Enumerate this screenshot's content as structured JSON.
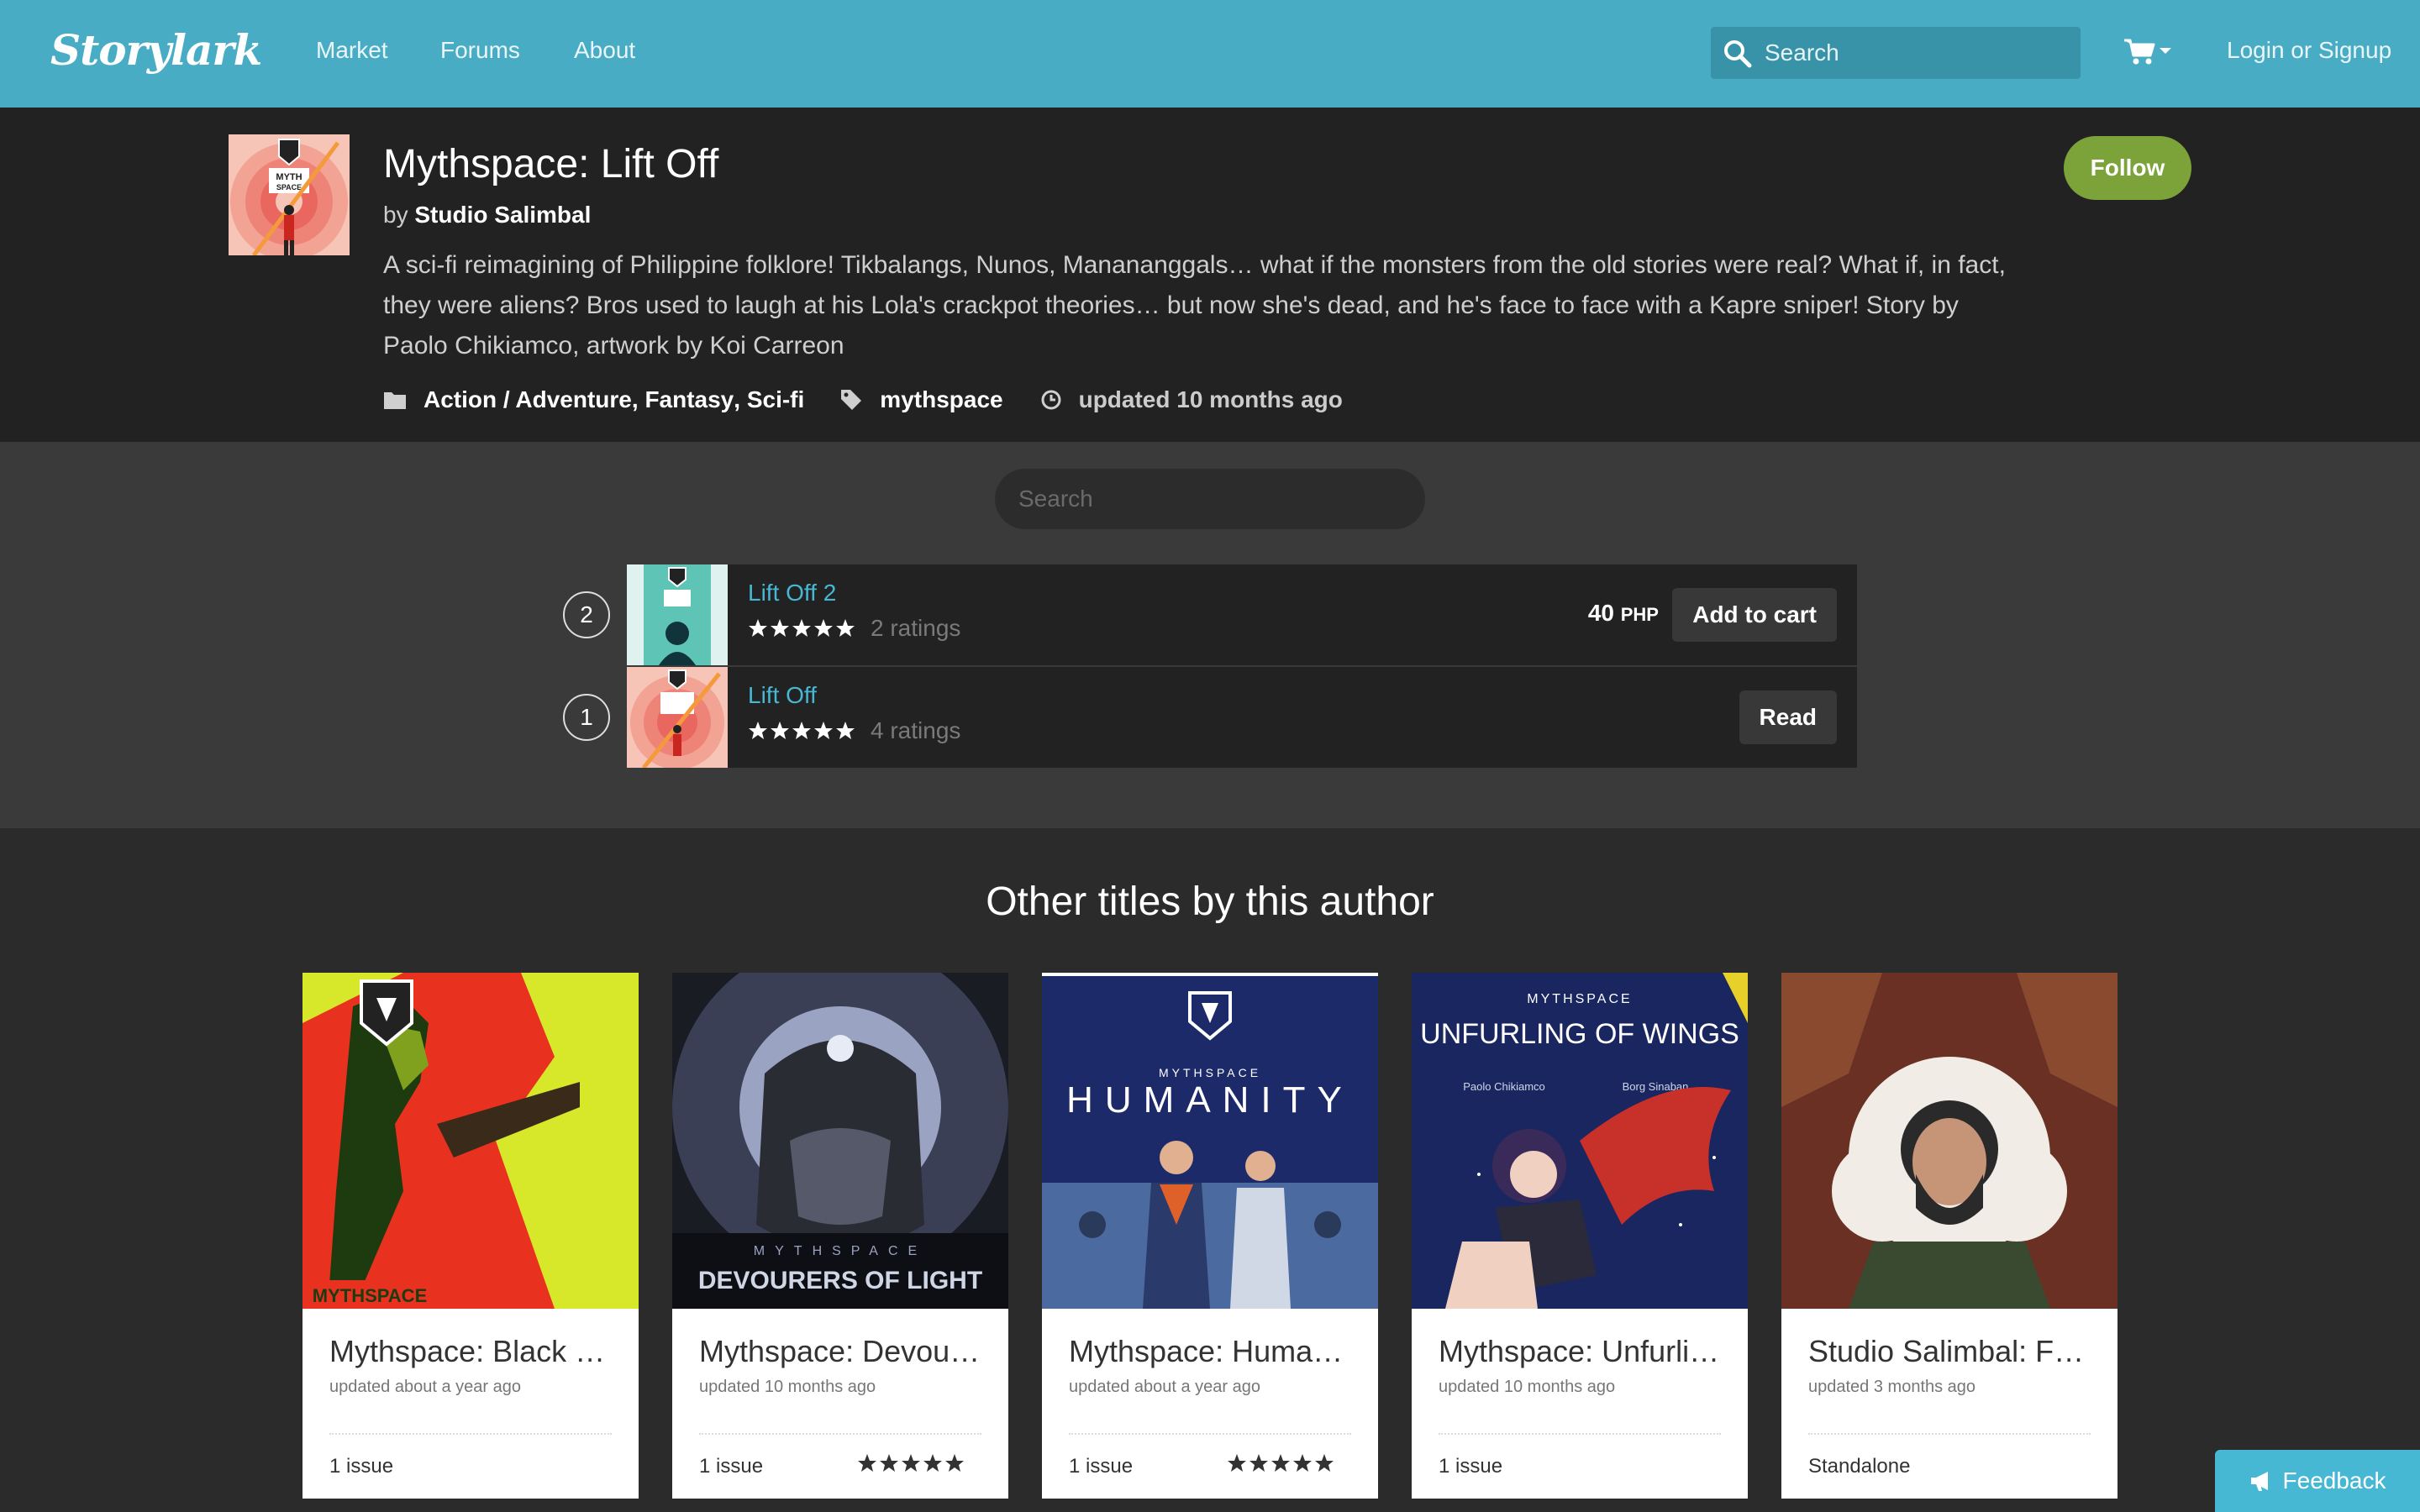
{
  "navbar": {
    "logo": "Storylark",
    "links": [
      "Market",
      "Forums",
      "About"
    ],
    "search_placeholder": "Search",
    "login": "Login or Signup"
  },
  "series": {
    "title": "Mythspace: Lift Off",
    "by_label": "by",
    "author": "Studio Salimbal",
    "description": "A sci-fi reimagining of Philippine folklore! Tikbalangs, Nunos, Manananggals… what if the monsters from the old stories were real? What if, in fact, they were aliens? Bros used to laugh at his Lola's crackpot theories… but now she's dead, and he's face to face with a Kapre sniper! Story by Paolo Chikiamco, artwork by Koi Carreon",
    "genres": [
      "Action / Adventure",
      "Fantasy",
      "Sci-fi"
    ],
    "tag": "mythspace",
    "updated": "updated 10 months ago",
    "follow_label": "Follow"
  },
  "issues": {
    "search_placeholder": "Search",
    "items": [
      {
        "number": "2",
        "name": "Lift Off 2",
        "ratings": "2 ratings",
        "price": "40",
        "currency": "PHP",
        "action": "Add to cart",
        "stars": 5
      },
      {
        "number": "1",
        "name": "Lift Off",
        "ratings": "4 ratings",
        "action": "Read",
        "stars": 5
      }
    ]
  },
  "other_titles": {
    "heading": "Other titles by this author",
    "cards": [
      {
        "title": "Mythspace: Black m…",
        "updated": "updated about a year ago",
        "issues": "1 issue",
        "stars": 0
      },
      {
        "title": "Mythspace: Devour…",
        "updated": "updated 10 months ago",
        "issues": "1 issue",
        "stars": 5
      },
      {
        "title": "Mythspace: Human…",
        "updated": "updated about a year ago",
        "issues": "1 issue",
        "stars": 5
      },
      {
        "title": "Mythspace: Unfurli…",
        "updated": "updated 10 months ago",
        "issues": "1 issue",
        "stars": 0
      },
      {
        "title": "Studio Salimbal: FC…",
        "updated": "updated 3 months ago",
        "issues": "Standalone",
        "stars": 0
      }
    ],
    "cover_lettering": {
      "black": "MYTHSPACE",
      "devourers_small": "MYTHSPACE",
      "devourers": "DEVOURERS OF LIGHT",
      "humanity_small": "MYTHSPACE",
      "humanity": "HUMANITY",
      "unfurling_small": "MYTHSPACE",
      "unfurling": "UNFURLING OF WINGS",
      "unfurling_credits_1": "Paolo Chikiamco",
      "unfurling_credits_2": "Borg Sinaban"
    }
  },
  "feedback_label": "Feedback",
  "colors": {
    "navbar": "#48adc4",
    "accent": "#47b8d4",
    "follow": "#7ca33a",
    "header_bg": "#222222",
    "issues_bg": "#3a3a3a"
  }
}
